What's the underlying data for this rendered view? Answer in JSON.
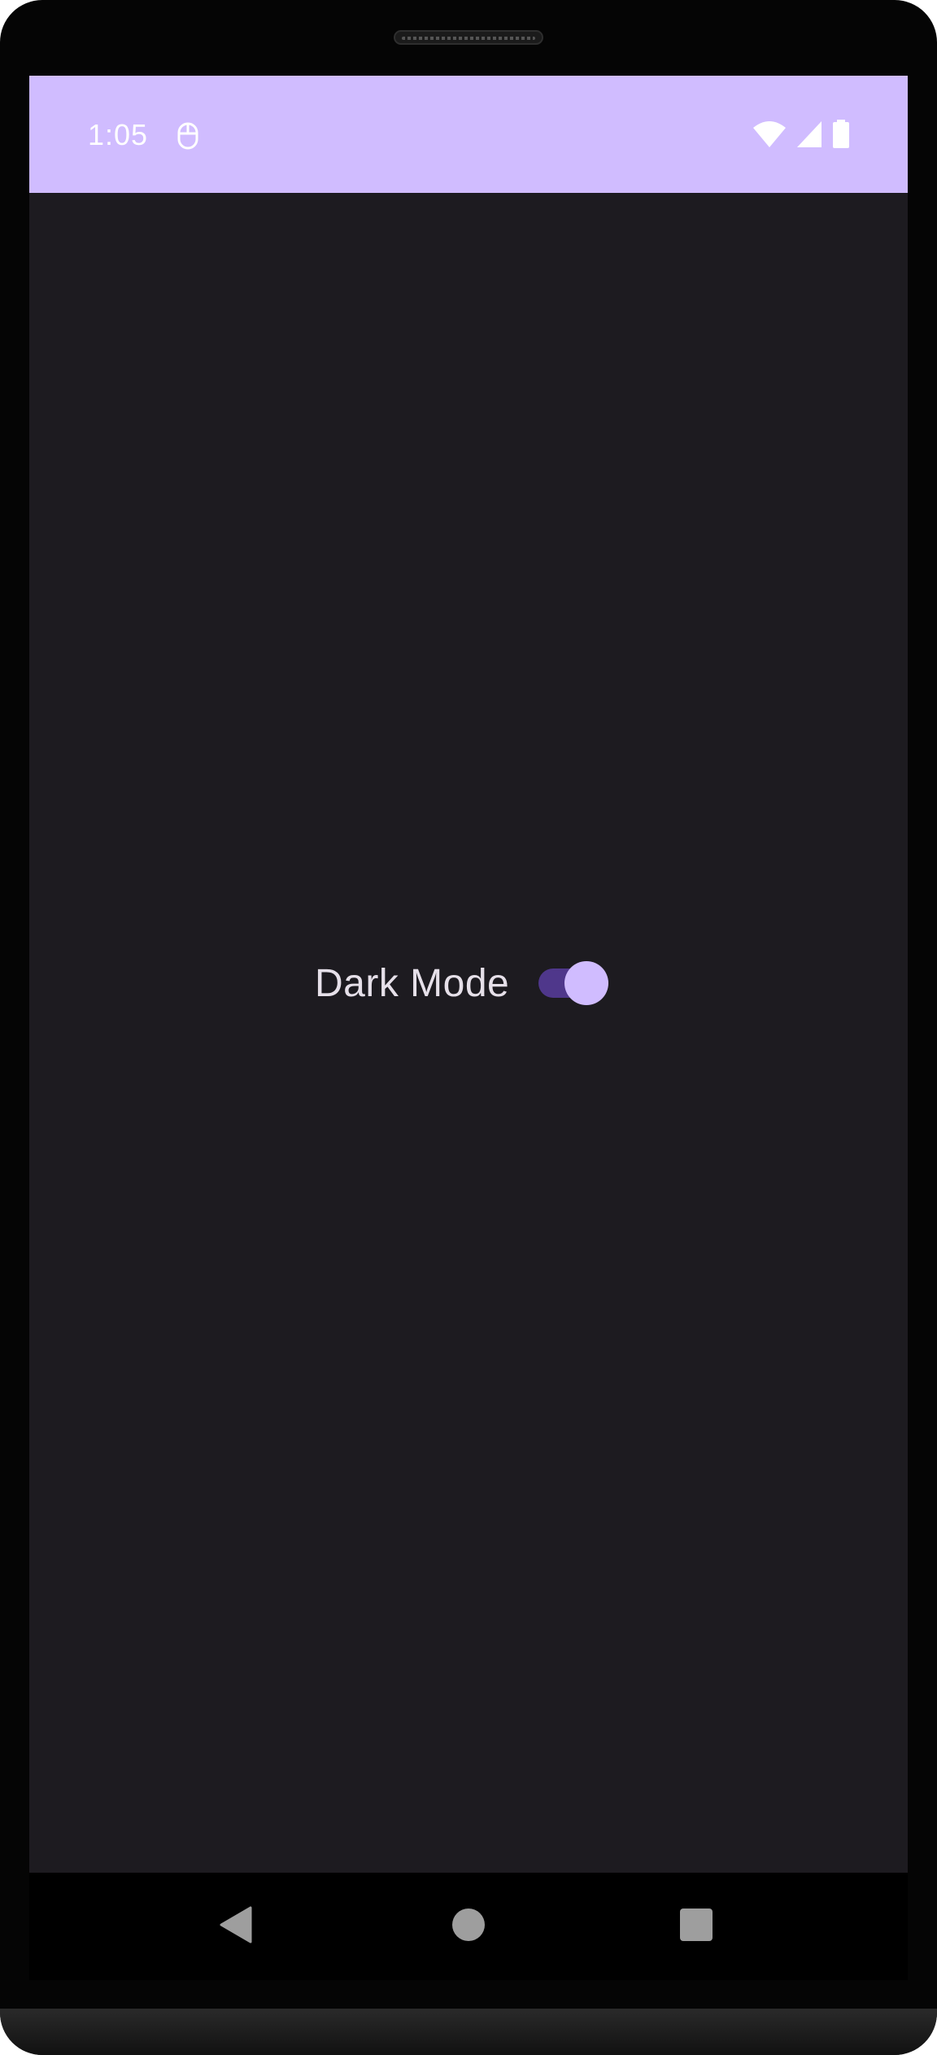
{
  "status_bar": {
    "time": "1:05",
    "notification_icon": "mouse-icon",
    "icons": [
      "wifi-icon",
      "cell-signal-icon",
      "battery-icon"
    ],
    "background_color": "#d0bcff"
  },
  "main": {
    "toggle_label": "Dark Mode",
    "toggle_state": "on",
    "background_color": "#1d1b20",
    "switch_track_color": "#4f378b",
    "switch_thumb_color": "#d0bcff"
  },
  "navigation_bar": {
    "buttons": [
      "back-icon",
      "home-icon",
      "recents-icon"
    ]
  }
}
